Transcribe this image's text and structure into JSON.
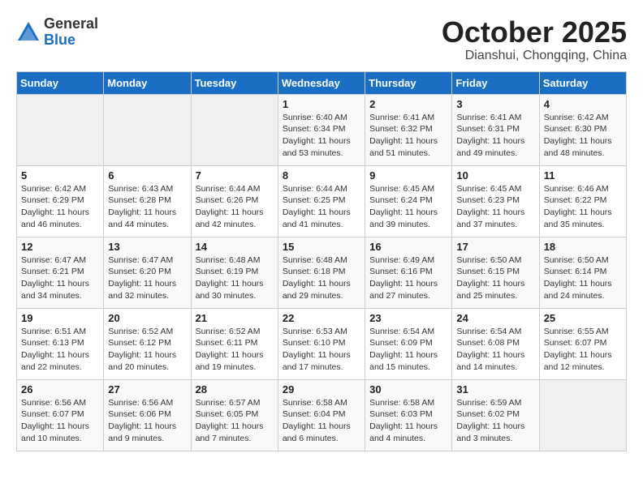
{
  "header": {
    "logo_general": "General",
    "logo_blue": "Blue",
    "month_title": "October 2025",
    "location": "Dianshui, Chongqing, China"
  },
  "days_of_week": [
    "Sunday",
    "Monday",
    "Tuesday",
    "Wednesday",
    "Thursday",
    "Friday",
    "Saturday"
  ],
  "weeks": [
    [
      {
        "day": "",
        "info": ""
      },
      {
        "day": "",
        "info": ""
      },
      {
        "day": "",
        "info": ""
      },
      {
        "day": "1",
        "info": "Sunrise: 6:40 AM\nSunset: 6:34 PM\nDaylight: 11 hours\nand 53 minutes."
      },
      {
        "day": "2",
        "info": "Sunrise: 6:41 AM\nSunset: 6:32 PM\nDaylight: 11 hours\nand 51 minutes."
      },
      {
        "day": "3",
        "info": "Sunrise: 6:41 AM\nSunset: 6:31 PM\nDaylight: 11 hours\nand 49 minutes."
      },
      {
        "day": "4",
        "info": "Sunrise: 6:42 AM\nSunset: 6:30 PM\nDaylight: 11 hours\nand 48 minutes."
      }
    ],
    [
      {
        "day": "5",
        "info": "Sunrise: 6:42 AM\nSunset: 6:29 PM\nDaylight: 11 hours\nand 46 minutes."
      },
      {
        "day": "6",
        "info": "Sunrise: 6:43 AM\nSunset: 6:28 PM\nDaylight: 11 hours\nand 44 minutes."
      },
      {
        "day": "7",
        "info": "Sunrise: 6:44 AM\nSunset: 6:26 PM\nDaylight: 11 hours\nand 42 minutes."
      },
      {
        "day": "8",
        "info": "Sunrise: 6:44 AM\nSunset: 6:25 PM\nDaylight: 11 hours\nand 41 minutes."
      },
      {
        "day": "9",
        "info": "Sunrise: 6:45 AM\nSunset: 6:24 PM\nDaylight: 11 hours\nand 39 minutes."
      },
      {
        "day": "10",
        "info": "Sunrise: 6:45 AM\nSunset: 6:23 PM\nDaylight: 11 hours\nand 37 minutes."
      },
      {
        "day": "11",
        "info": "Sunrise: 6:46 AM\nSunset: 6:22 PM\nDaylight: 11 hours\nand 35 minutes."
      }
    ],
    [
      {
        "day": "12",
        "info": "Sunrise: 6:47 AM\nSunset: 6:21 PM\nDaylight: 11 hours\nand 34 minutes."
      },
      {
        "day": "13",
        "info": "Sunrise: 6:47 AM\nSunset: 6:20 PM\nDaylight: 11 hours\nand 32 minutes."
      },
      {
        "day": "14",
        "info": "Sunrise: 6:48 AM\nSunset: 6:19 PM\nDaylight: 11 hours\nand 30 minutes."
      },
      {
        "day": "15",
        "info": "Sunrise: 6:48 AM\nSunset: 6:18 PM\nDaylight: 11 hours\nand 29 minutes."
      },
      {
        "day": "16",
        "info": "Sunrise: 6:49 AM\nSunset: 6:16 PM\nDaylight: 11 hours\nand 27 minutes."
      },
      {
        "day": "17",
        "info": "Sunrise: 6:50 AM\nSunset: 6:15 PM\nDaylight: 11 hours\nand 25 minutes."
      },
      {
        "day": "18",
        "info": "Sunrise: 6:50 AM\nSunset: 6:14 PM\nDaylight: 11 hours\nand 24 minutes."
      }
    ],
    [
      {
        "day": "19",
        "info": "Sunrise: 6:51 AM\nSunset: 6:13 PM\nDaylight: 11 hours\nand 22 minutes."
      },
      {
        "day": "20",
        "info": "Sunrise: 6:52 AM\nSunset: 6:12 PM\nDaylight: 11 hours\nand 20 minutes."
      },
      {
        "day": "21",
        "info": "Sunrise: 6:52 AM\nSunset: 6:11 PM\nDaylight: 11 hours\nand 19 minutes."
      },
      {
        "day": "22",
        "info": "Sunrise: 6:53 AM\nSunset: 6:10 PM\nDaylight: 11 hours\nand 17 minutes."
      },
      {
        "day": "23",
        "info": "Sunrise: 6:54 AM\nSunset: 6:09 PM\nDaylight: 11 hours\nand 15 minutes."
      },
      {
        "day": "24",
        "info": "Sunrise: 6:54 AM\nSunset: 6:08 PM\nDaylight: 11 hours\nand 14 minutes."
      },
      {
        "day": "25",
        "info": "Sunrise: 6:55 AM\nSunset: 6:07 PM\nDaylight: 11 hours\nand 12 minutes."
      }
    ],
    [
      {
        "day": "26",
        "info": "Sunrise: 6:56 AM\nSunset: 6:07 PM\nDaylight: 11 hours\nand 10 minutes."
      },
      {
        "day": "27",
        "info": "Sunrise: 6:56 AM\nSunset: 6:06 PM\nDaylight: 11 hours\nand 9 minutes."
      },
      {
        "day": "28",
        "info": "Sunrise: 6:57 AM\nSunset: 6:05 PM\nDaylight: 11 hours\nand 7 minutes."
      },
      {
        "day": "29",
        "info": "Sunrise: 6:58 AM\nSunset: 6:04 PM\nDaylight: 11 hours\nand 6 minutes."
      },
      {
        "day": "30",
        "info": "Sunrise: 6:58 AM\nSunset: 6:03 PM\nDaylight: 11 hours\nand 4 minutes."
      },
      {
        "day": "31",
        "info": "Sunrise: 6:59 AM\nSunset: 6:02 PM\nDaylight: 11 hours\nand 3 minutes."
      },
      {
        "day": "",
        "info": ""
      }
    ]
  ]
}
